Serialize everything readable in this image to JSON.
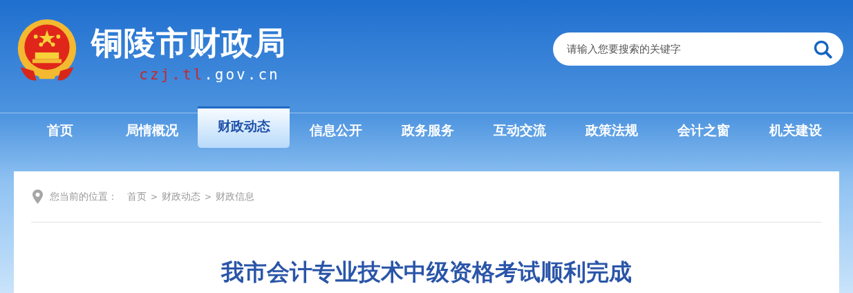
{
  "header": {
    "site_name": "铜陵市财政局",
    "domain": {
      "accent": "czj.tl",
      "rest": ".gov.cn"
    },
    "search": {
      "placeholder": "请输入您要搜索的关键字"
    }
  },
  "nav": [
    {
      "label": "首页",
      "selected": false
    },
    {
      "label": "局情概况",
      "selected": false
    },
    {
      "label": "财政动态",
      "selected": true
    },
    {
      "label": "信息公开",
      "selected": false
    },
    {
      "label": "政务服务",
      "selected": false
    },
    {
      "label": "互动交流",
      "selected": false
    },
    {
      "label": "政策法规",
      "selected": false
    },
    {
      "label": "会计之窗",
      "selected": false
    },
    {
      "label": "机关建设",
      "selected": false
    }
  ],
  "breadcrumb": {
    "label": "您当前的位置：",
    "items": [
      {
        "kind": "link",
        "text": "首页"
      },
      {
        "kind": "separator",
        "text": ">"
      },
      {
        "kind": "link",
        "text": "财政动态"
      },
      {
        "kind": "separator",
        "text": ">"
      },
      {
        "kind": "link",
        "text": "财政信息"
      }
    ]
  },
  "article": {
    "title": "我市会计专业技术中级资格考试顺利完成"
  }
}
